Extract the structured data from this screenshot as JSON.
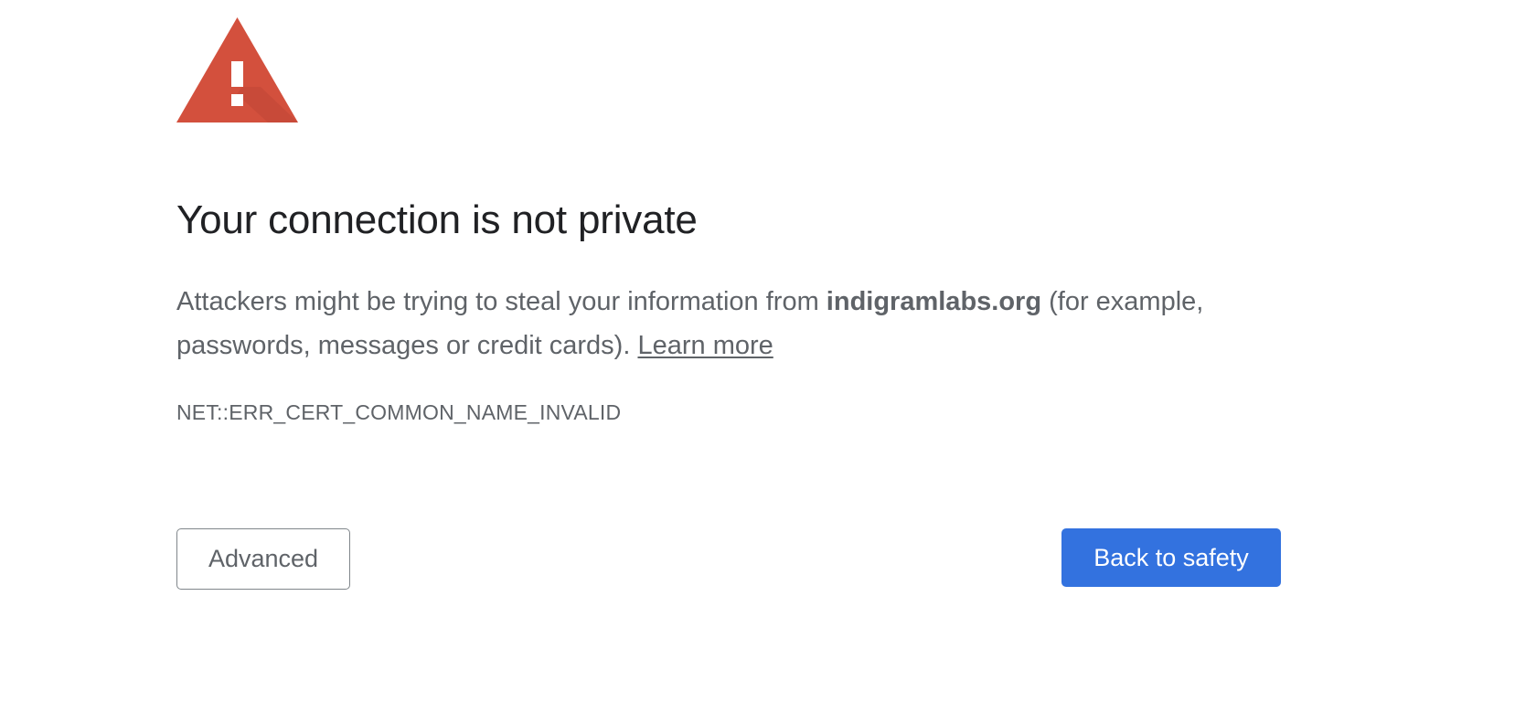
{
  "page": {
    "title": "Your connection is not private",
    "message_prefix": "Attackers might be trying to steal your information from ",
    "domain": "indigramlabs.org",
    "message_suffix": " (for example, passwords, messages or credit cards). ",
    "learn_more": "Learn more",
    "error_code": "NET::ERR_CERT_COMMON_NAME_INVALID"
  },
  "buttons": {
    "advanced_label": "Advanced",
    "back_label": "Back to safety"
  },
  "icons": {
    "warning": "warning-triangle-icon"
  },
  "colors": {
    "warning_red": "#d3503d",
    "primary_blue": "#3372df",
    "heading_text": "#202124",
    "body_text": "#5f6368"
  }
}
